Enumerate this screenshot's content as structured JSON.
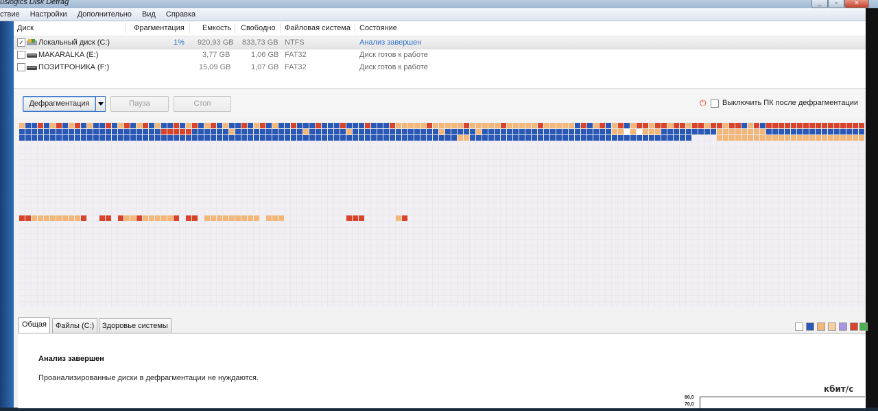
{
  "window": {
    "title": "uslogics Disk Defrag",
    "controls": [
      "_",
      "▫",
      "✕"
    ]
  },
  "menu": [
    "ствие",
    "Настройки",
    "Дополнительно",
    "Вид",
    "Справка"
  ],
  "drive_table": {
    "headers": {
      "disk": "Диск",
      "fragmentation": "Фрагментация",
      "capacity": "Емкость",
      "free": "Свободно",
      "filesystem": "Файловая система",
      "status": "Состояние"
    },
    "rows": [
      {
        "checked": true,
        "icon": "system-drive-icon",
        "name": "Локальный диск (C:)",
        "fragmentation": "1%",
        "capacity": "920,93 GB",
        "free": "833,73 GB",
        "filesystem": "NTFS",
        "status": "Анализ завершен",
        "status_color": "#2a6fc7"
      },
      {
        "checked": false,
        "icon": "removable-drive-icon",
        "name": "MAKARALKA (E:)",
        "fragmentation": "",
        "capacity": "3,77 GB",
        "free": "1,06 GB",
        "filesystem": "FAT32",
        "status": "Диск готов к работе",
        "status_color": "#666666"
      },
      {
        "checked": false,
        "icon": "removable-drive-icon",
        "name": "ПОЗИТРОНИКА (F:)",
        "fragmentation": "",
        "capacity": "15,09 GB",
        "free": "1,07 GB",
        "filesystem": "FAT32",
        "status": "Диск готов к работе",
        "status_color": "#666666"
      }
    ]
  },
  "toolbar": {
    "defrag_label": "Дефрагментация",
    "pause_label": "Пауза",
    "stop_label": "Стоп",
    "shutdown_label": "Выключить ПК после дефрагментации",
    "power_icon": "power-icon"
  },
  "cluster_map": {
    "columns": 144,
    "rows": 30,
    "colors": {
      "fragmented": "#f3b77a",
      "fragmented_dark": "#d9432b",
      "files": "#2a58b7",
      "free": "#f1eef4",
      "unmovable": "#ffffff"
    }
  },
  "tabs": {
    "general": "Общая",
    "files": "Файлы (C:)",
    "health": "Здоровье системы"
  },
  "legend_colors": [
    "#ffffff",
    "#2a58b7",
    "#f3b77a",
    "#f6cfa0",
    "#a695e0",
    "#d9432b",
    "#4caf50"
  ],
  "panel": {
    "title": "Анализ завершен",
    "message": "Проанализированные диски в дефрагментации не нуждаются.",
    "chart_unit": "кбит/с",
    "y_ticks": [
      "80,0",
      "70,0"
    ]
  }
}
